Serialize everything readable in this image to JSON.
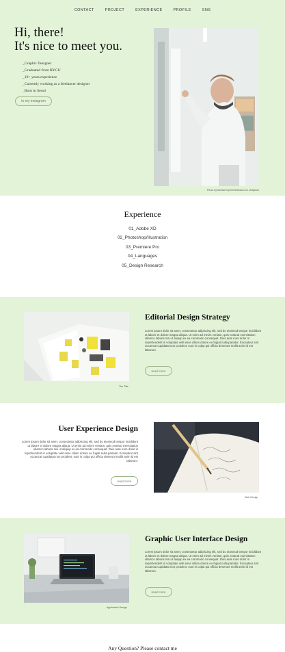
{
  "nav": [
    "CONTACT",
    "PROJECT",
    "EXPERIENCE",
    "PROFILE",
    "SNS"
  ],
  "hero": {
    "title_line1": "Hi, there!",
    "title_line2": "It's nice to meet you.",
    "bullets": [
      "_Graphic Designer",
      "_Graduated from HYCU",
      "_10+ years experience",
      "_Currently working as a freelancer designer",
      "_Born in Seoul"
    ],
    "button": "to my instagram",
    "credit": "Photo by Mental Expert/Gelbvision on Unsplash"
  },
  "experience": {
    "heading": "Experience",
    "items": [
      "01_Adobe XD",
      "02_Photoshop/Illustration",
      "03_Premiere Pro",
      "04_Languages",
      "05_Design Research"
    ]
  },
  "sections": [
    {
      "title": "Editorial Design Strategy",
      "body": "Lorem ipsum dolor sit amet, consectetur adipiscing elit, sed do eiusmod tempor incididunt ut labore et dolore magna aliqua. Ut enim ad minim veniam, quis nostrud exercitation ullamco laboris nisi ut aliquip ex ea commodo consequat. Duis aute irure dolor in reprehenderit in voluptate velit esse cillum dolore eu fugiat nulla pariatur. Excepteur sint occaecat cupidatat non proident, sunt in culpa qui officia deserunt mollit anim id est laborum.",
      "button": "read more",
      "caption": "The Title"
    },
    {
      "title": "User Experience Design",
      "body": "Lorem ipsum dolor sit amet, consectetur adipiscing elit, sed do eiusmod tempor incididunt ut labore et dolore magna aliqua. Ut enim ad minim veniam, quis nostrud exercitation ullamco laboris nisi ut aliquip ex ea commodo consequat. Duis aute irure dolor in reprehenderit in voluptate velit esse cillum dolore eu fugiat nulla pariatur. Excepteur sint occaecat cupidatat non proident, sunt in culpa qui officia deserunt mollit anim id est laborum.",
      "button": "read more",
      "caption": "Web Design"
    },
    {
      "title": "Graphic User Interface Design",
      "body": "Lorem ipsum dolor sit amet, consectetur adipiscing elit, sed do eiusmod tempor incididunt ut labore et dolore magna aliqua. Ut enim ad minim veniam, quis nostrud exercitation ullamco laboris nisi ut aliquip ex ea commodo consequat. Duis aute irure dolor in reprehenderit in voluptate velit esse cillum dolore eu fugiat nulla pariatur. Excepteur sint occaecat cupidatat non proident, sunt in culpa qui officia deserunt mollit anim id est laborum.",
      "button": "read more",
      "caption": "Application Design"
    }
  ],
  "footer": {
    "text": "Any Question? Please contact me"
  },
  "colors": {
    "green_band": "#e3f3d8",
    "button_border": "#9bb58a"
  }
}
